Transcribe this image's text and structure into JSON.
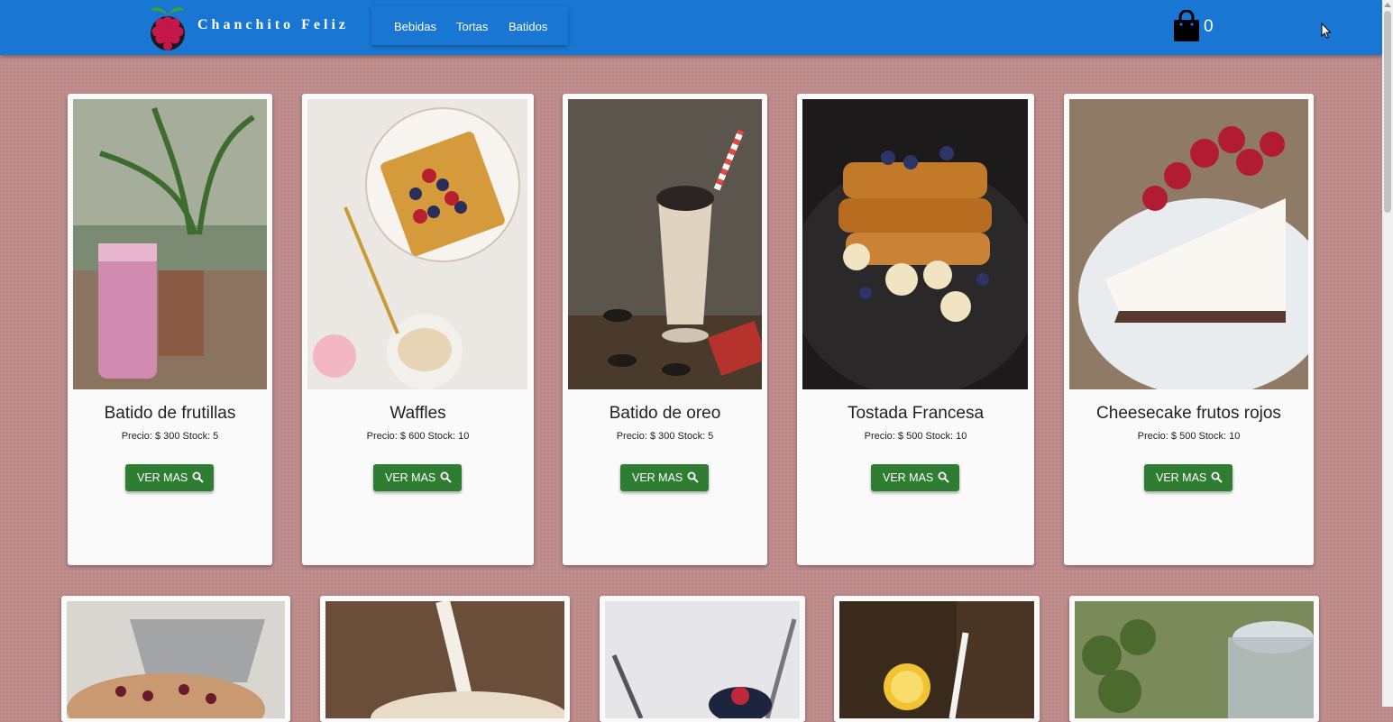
{
  "header": {
    "brand": "Chanchito Feliz",
    "nav": [
      "Bebidas",
      "Tortas",
      "Batidos"
    ],
    "cart_count": "0"
  },
  "button_label": "VER MAS",
  "products": [
    {
      "name": "Batido de frutillas",
      "meta": "Precio: $ 300 Stock: 5"
    },
    {
      "name": "Waffles",
      "meta": "Precio: $ 600 Stock: 10"
    },
    {
      "name": "Batido de oreo",
      "meta": "Precio: $ 300 Stock: 5"
    },
    {
      "name": "Tostada Francesa",
      "meta": "Precio: $ 500 Stock: 10"
    },
    {
      "name": "Cheesecake frutos rojos",
      "meta": "Precio: $ 500 Stock: 10"
    }
  ],
  "icons": {
    "brand": "raspberry-logo-icon",
    "cart": "shopping-bag-icon",
    "button": "search-icon"
  },
  "colors": {
    "appbar": "#1976d2",
    "button": "#2e7d32",
    "background": "#bd8a8a"
  }
}
